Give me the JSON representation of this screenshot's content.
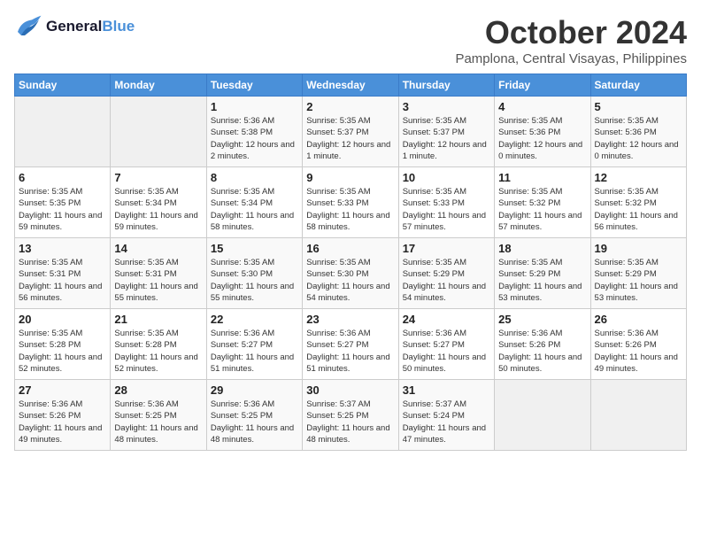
{
  "header": {
    "logo_line1": "General",
    "logo_line2": "Blue",
    "month": "October 2024",
    "location": "Pamplona, Central Visayas, Philippines"
  },
  "days_of_week": [
    "Sunday",
    "Monday",
    "Tuesday",
    "Wednesday",
    "Thursday",
    "Friday",
    "Saturday"
  ],
  "weeks": [
    [
      {
        "day": "",
        "empty": true
      },
      {
        "day": "",
        "empty": true
      },
      {
        "day": "1",
        "sunrise": "5:36 AM",
        "sunset": "5:38 PM",
        "daylight": "12 hours and 2 minutes."
      },
      {
        "day": "2",
        "sunrise": "5:35 AM",
        "sunset": "5:37 PM",
        "daylight": "12 hours and 1 minute."
      },
      {
        "day": "3",
        "sunrise": "5:35 AM",
        "sunset": "5:37 PM",
        "daylight": "12 hours and 1 minute."
      },
      {
        "day": "4",
        "sunrise": "5:35 AM",
        "sunset": "5:36 PM",
        "daylight": "12 hours and 0 minutes."
      },
      {
        "day": "5",
        "sunrise": "5:35 AM",
        "sunset": "5:36 PM",
        "daylight": "12 hours and 0 minutes."
      }
    ],
    [
      {
        "day": "6",
        "sunrise": "5:35 AM",
        "sunset": "5:35 PM",
        "daylight": "11 hours and 59 minutes."
      },
      {
        "day": "7",
        "sunrise": "5:35 AM",
        "sunset": "5:34 PM",
        "daylight": "11 hours and 59 minutes."
      },
      {
        "day": "8",
        "sunrise": "5:35 AM",
        "sunset": "5:34 PM",
        "daylight": "11 hours and 58 minutes."
      },
      {
        "day": "9",
        "sunrise": "5:35 AM",
        "sunset": "5:33 PM",
        "daylight": "11 hours and 58 minutes."
      },
      {
        "day": "10",
        "sunrise": "5:35 AM",
        "sunset": "5:33 PM",
        "daylight": "11 hours and 57 minutes."
      },
      {
        "day": "11",
        "sunrise": "5:35 AM",
        "sunset": "5:32 PM",
        "daylight": "11 hours and 57 minutes."
      },
      {
        "day": "12",
        "sunrise": "5:35 AM",
        "sunset": "5:32 PM",
        "daylight": "11 hours and 56 minutes."
      }
    ],
    [
      {
        "day": "13",
        "sunrise": "5:35 AM",
        "sunset": "5:31 PM",
        "daylight": "11 hours and 56 minutes."
      },
      {
        "day": "14",
        "sunrise": "5:35 AM",
        "sunset": "5:31 PM",
        "daylight": "11 hours and 55 minutes."
      },
      {
        "day": "15",
        "sunrise": "5:35 AM",
        "sunset": "5:30 PM",
        "daylight": "11 hours and 55 minutes."
      },
      {
        "day": "16",
        "sunrise": "5:35 AM",
        "sunset": "5:30 PM",
        "daylight": "11 hours and 54 minutes."
      },
      {
        "day": "17",
        "sunrise": "5:35 AM",
        "sunset": "5:29 PM",
        "daylight": "11 hours and 54 minutes."
      },
      {
        "day": "18",
        "sunrise": "5:35 AM",
        "sunset": "5:29 PM",
        "daylight": "11 hours and 53 minutes."
      },
      {
        "day": "19",
        "sunrise": "5:35 AM",
        "sunset": "5:29 PM",
        "daylight": "11 hours and 53 minutes."
      }
    ],
    [
      {
        "day": "20",
        "sunrise": "5:35 AM",
        "sunset": "5:28 PM",
        "daylight": "11 hours and 52 minutes."
      },
      {
        "day": "21",
        "sunrise": "5:35 AM",
        "sunset": "5:28 PM",
        "daylight": "11 hours and 52 minutes."
      },
      {
        "day": "22",
        "sunrise": "5:36 AM",
        "sunset": "5:27 PM",
        "daylight": "11 hours and 51 minutes."
      },
      {
        "day": "23",
        "sunrise": "5:36 AM",
        "sunset": "5:27 PM",
        "daylight": "11 hours and 51 minutes."
      },
      {
        "day": "24",
        "sunrise": "5:36 AM",
        "sunset": "5:27 PM",
        "daylight": "11 hours and 50 minutes."
      },
      {
        "day": "25",
        "sunrise": "5:36 AM",
        "sunset": "5:26 PM",
        "daylight": "11 hours and 50 minutes."
      },
      {
        "day": "26",
        "sunrise": "5:36 AM",
        "sunset": "5:26 PM",
        "daylight": "11 hours and 49 minutes."
      }
    ],
    [
      {
        "day": "27",
        "sunrise": "5:36 AM",
        "sunset": "5:26 PM",
        "daylight": "11 hours and 49 minutes."
      },
      {
        "day": "28",
        "sunrise": "5:36 AM",
        "sunset": "5:25 PM",
        "daylight": "11 hours and 48 minutes."
      },
      {
        "day": "29",
        "sunrise": "5:36 AM",
        "sunset": "5:25 PM",
        "daylight": "11 hours and 48 minutes."
      },
      {
        "day": "30",
        "sunrise": "5:37 AM",
        "sunset": "5:25 PM",
        "daylight": "11 hours and 48 minutes."
      },
      {
        "day": "31",
        "sunrise": "5:37 AM",
        "sunset": "5:24 PM",
        "daylight": "11 hours and 47 minutes."
      },
      {
        "day": "",
        "empty": true
      },
      {
        "day": "",
        "empty": true
      }
    ]
  ]
}
